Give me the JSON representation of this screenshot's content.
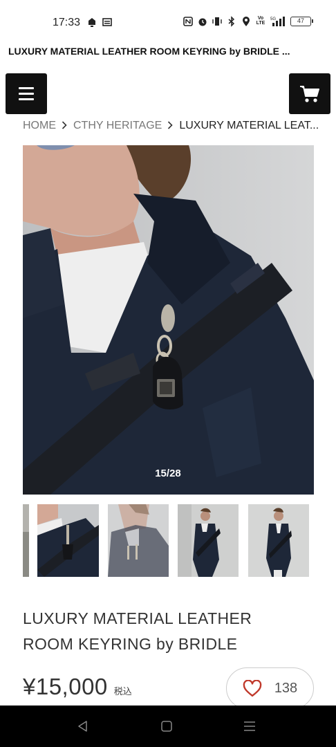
{
  "status_bar": {
    "time": "17:33",
    "left_icons": [
      "notification-icon",
      "news-icon"
    ],
    "right_icons": [
      "nfc-icon",
      "alarm-icon",
      "vibrate-icon",
      "bluetooth-icon",
      "location-icon",
      "volte-icon",
      "signal-icon"
    ],
    "network": "5G",
    "volte": "Vo LTE",
    "battery": "47"
  },
  "page": {
    "title": "LUXURY MATERIAL LEATHER ROOM KEYRING by BRIDLE ..."
  },
  "header": {
    "menu_icon": "hamburger-menu-icon",
    "cart_icon": "shopping-cart-icon"
  },
  "breadcrumb": {
    "items": [
      "HOME",
      "CTHY HERITAGE",
      "LUXURY MATERIAL LEAT..."
    ],
    "separator_icon": "chevron-right-icon"
  },
  "gallery": {
    "counter": "15/28",
    "thumbnails": 5
  },
  "product": {
    "title_line1": "LUXURY MATERIAL LEATHER",
    "title_line2": "ROOM KEYRING by BRIDLE",
    "price": "¥15,000",
    "tax_label": "税込",
    "favorite_icon": "heart-icon",
    "favorite_count": "138",
    "accent_color": "#c0392b"
  },
  "nav_bar": {
    "back_icon": "back-triangle-icon",
    "home_icon": "home-square-icon",
    "recents_icon": "recents-lines-icon"
  }
}
